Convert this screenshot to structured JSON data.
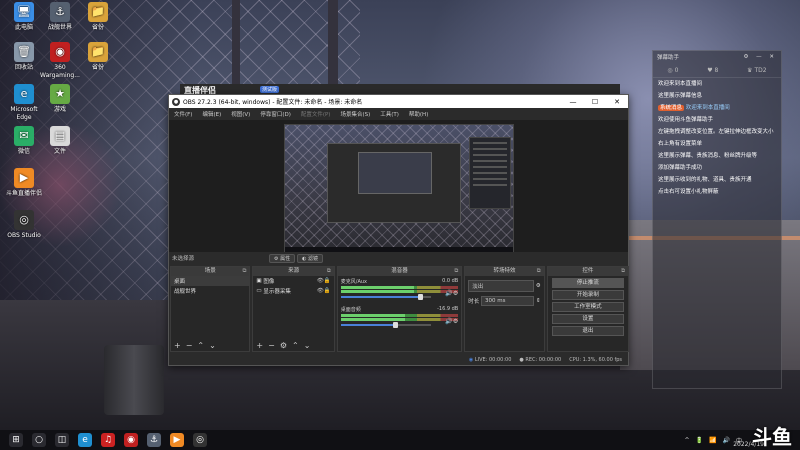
{
  "desktop_icons": [
    {
      "label": "此电脑",
      "icon": "computer-icon",
      "color": "#3a8ee6"
    },
    {
      "label": "战舰世界",
      "icon": "warships-icon",
      "color": "#556070"
    },
    {
      "label": "省份",
      "icon": "folder-icon",
      "color": "#d9a33a"
    },
    {
      "label": "回收站",
      "icon": "recycle-bin-icon",
      "color": "#8898aa"
    },
    {
      "label": "360 Wargaming...",
      "icon": "wargaming-icon",
      "color": "#c02020"
    },
    {
      "label": "省份",
      "icon": "folder-icon",
      "color": "#d9a33a"
    },
    {
      "label": "Microsoft Edge",
      "icon": "edge-icon",
      "color": "#1f8fd0"
    },
    {
      "label": "游戏",
      "icon": "game-icon",
      "color": "#6a4"
    },
    {
      "label": "微信",
      "icon": "wechat-icon",
      "color": "#2aae67"
    },
    {
      "label": "文件",
      "icon": "file-icon",
      "color": "#d9d9d9"
    },
    {
      "label": "斗鱼直播伴侣",
      "icon": "douyu-companion-icon",
      "color": "#f08a24"
    },
    {
      "label": "OBS Studio",
      "icon": "obs-icon",
      "color": "#333"
    }
  ],
  "brand_bar": {
    "logo": "直播伴侣",
    "badge": "测试版"
  },
  "obs": {
    "title": "OBS 27.2.3 (64-bit, windows) - 配置文件: 未命名 - 场景: 未命名",
    "window_controls": [
      "—",
      "☐",
      "✕"
    ],
    "menu": [
      {
        "label": "文件(F)",
        "dim": false
      },
      {
        "label": "编辑(E)",
        "dim": false
      },
      {
        "label": "视图(V)",
        "dim": false
      },
      {
        "label": "停靠窗口(D)",
        "dim": false
      },
      {
        "label": "配置文件(P)",
        "dim": true
      },
      {
        "label": "场景集合(S)",
        "dim": false
      },
      {
        "label": "工具(T)",
        "dim": false
      },
      {
        "label": "帮助(H)",
        "dim": false
      }
    ],
    "source_bar": {
      "no_selection": "未选择源",
      "properties": "属性",
      "filters": "滤镜"
    },
    "docks": {
      "scenes": {
        "title": "场景",
        "items": [
          "桌面",
          "战舰世界"
        ],
        "selected": 0
      },
      "sources": {
        "title": "来源",
        "items": [
          {
            "label": "图像",
            "icon": "image-icon"
          },
          {
            "label": "显示器采集",
            "icon": "monitor-icon"
          }
        ]
      },
      "mixer": {
        "title": "混音器",
        "channels": [
          {
            "name": "麦克风/Aux",
            "db": "0.0 dB",
            "level": 0.62,
            "volume": 0.88
          },
          {
            "name": "桌面音频",
            "db": "-16.9 dB",
            "level": 0.55,
            "volume": 0.6
          }
        ]
      },
      "transitions": {
        "title": "转场特效",
        "type": "淡出",
        "duration_label": "时长",
        "duration": "300 ms"
      },
      "controls": {
        "title": "控件",
        "buttons": [
          "停止推流",
          "开始录制",
          "工作室模式",
          "设置",
          "退出"
        ],
        "active": 0
      }
    },
    "status": {
      "live": "LIVE: 00:00:00",
      "rec": "REC: 00:00:00",
      "perf": "CPU: 1.3%, 60.00 fps"
    }
  },
  "chat": {
    "header": "弹幕助手",
    "tabs": [
      "0",
      "8",
      "TD2"
    ],
    "messages": [
      {
        "text": "欢迎来到本直播间 ",
        "user": "",
        "highlight": false
      },
      {
        "text": "这里展示弹幕信息",
        "user": "",
        "highlight": false
      },
      {
        "text": "欢迎来到本直播间",
        "user": "系统消息",
        "highlight": true
      },
      {
        "text": "欢迎使用斗鱼弹幕助手",
        "user": "",
        "highlight": false
      },
      {
        "text": "左键拖拽调整改变位置。左键拉伸边框改变大小",
        "user": "",
        "highlight": false
      },
      {
        "text": "右上角有设置菜单",
        "user": "",
        "highlight": false
      },
      {
        "text": "这里展示弹幕、贵族消息、粉丝牌升级等",
        "user": "",
        "highlight": false
      },
      {
        "text": "添加弹幕助手成功",
        "user": "",
        "highlight": false
      },
      {
        "text": "这里展示收到的礼物、道具、贵族开通",
        "user": "",
        "highlight": false
      },
      {
        "text": "点击右可设置小礼物屏蔽",
        "user": "",
        "highlight": false
      }
    ]
  },
  "taskbar": {
    "apps": [
      {
        "icon": "windows-start-icon",
        "color": "#2a2a30"
      },
      {
        "icon": "search-icon",
        "color": "#2a2a30"
      },
      {
        "icon": "task-view-icon",
        "color": "#2a2a30"
      },
      {
        "icon": "edge-icon",
        "color": "#1f8fd0"
      },
      {
        "icon": "netease-icon",
        "color": "#c22"
      },
      {
        "icon": "wargaming-icon",
        "color": "#c02020"
      },
      {
        "icon": "warships-icon",
        "color": "#556070"
      },
      {
        "icon": "douyu-companion-icon",
        "color": "#f08a24"
      },
      {
        "icon": "obs-icon",
        "color": "#333"
      }
    ],
    "tray": [
      "^",
      "🔋",
      "📶",
      "🔊",
      "中"
    ],
    "time": "2022/4/19"
  },
  "watermark": "斗鱼"
}
